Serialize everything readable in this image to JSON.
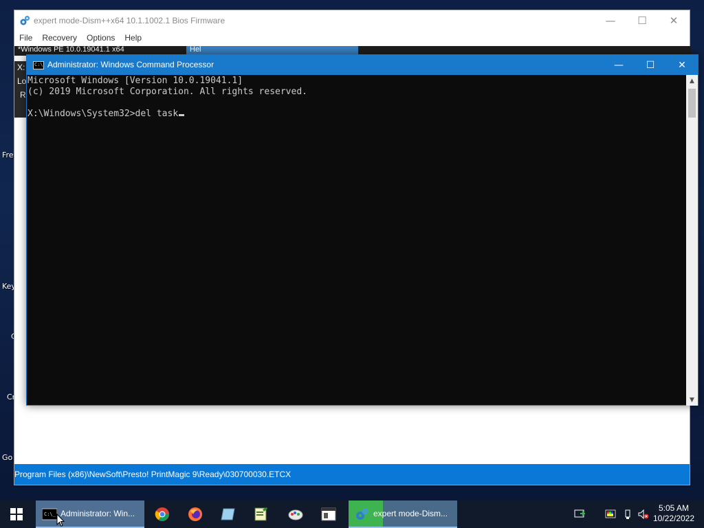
{
  "desktop": {
    "labels": [
      "Fre",
      "Key",
      "C",
      "Cr",
      "Go"
    ]
  },
  "dism": {
    "title": "expert mode-Dism++x64 10.1.1002.1 Bios Firmware",
    "menu": [
      "File",
      "Recovery",
      "Options",
      "Help"
    ],
    "behind_texts": [
      "*Windows PE 10.0.19041.1 x64",
      "X:",
      "Lo",
      "Re",
      "Hel"
    ],
    "status_path": "Program Files (x86)\\NewSoft\\Presto! PrintMagic 9\\Ready\\030700030.ETCX",
    "caption": {
      "minimize": "—",
      "maximize": "☐",
      "close": "✕"
    }
  },
  "cmd": {
    "title": "Administrator: Windows Command Processor",
    "caption": {
      "minimize": "—",
      "maximize": "☐",
      "close": "✕"
    },
    "lines": [
      "Microsoft Windows [Version 10.0.19041.1]",
      "(c) 2019 Microsoft Corporation. All rights reserved.",
      "",
      "X:\\Windows\\System32>del task"
    ],
    "scroll_up": "▲",
    "scroll_down": "▼"
  },
  "taskbar": {
    "items": [
      {
        "label": "Administrator: Win...",
        "icon": "cmd-icon"
      },
      {
        "label": "",
        "icon": "chrome-icon"
      },
      {
        "label": "",
        "icon": "firefox-icon"
      },
      {
        "label": "",
        "icon": "notepad-icon"
      },
      {
        "label": "",
        "icon": "editor-icon"
      },
      {
        "label": "",
        "icon": "paint-tool-icon"
      },
      {
        "label": "",
        "icon": "window-app-icon"
      },
      {
        "label": "expert mode-Dism...",
        "icon": "dism-icon"
      }
    ],
    "clock": {
      "time": "5:05 AM",
      "date": "10/22/2022"
    },
    "colors": {
      "taskbar": "#101a2b",
      "active": "#4f6f93",
      "accent": "#0a78d7"
    }
  }
}
